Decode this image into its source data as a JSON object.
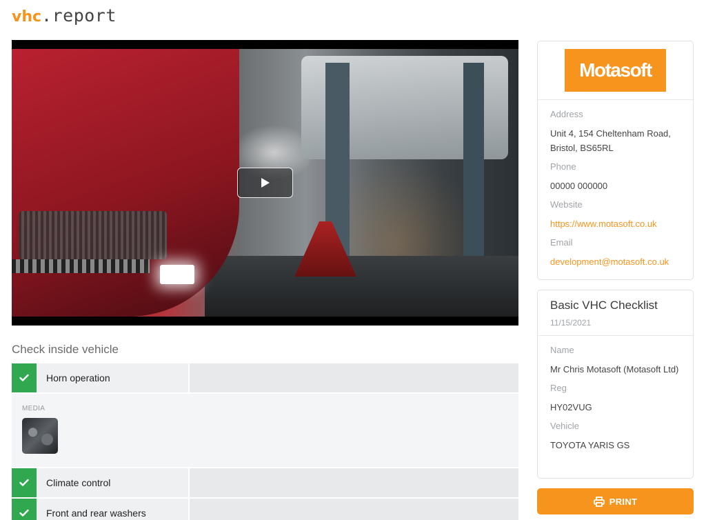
{
  "brand": {
    "part1": "vhc",
    "part2": ".report"
  },
  "video": {
    "play_icon": "play-icon"
  },
  "section": {
    "title": "Check inside vehicle"
  },
  "checks": [
    {
      "label": "Horn operation",
      "status": "pass"
    },
    {
      "label": "Climate control",
      "status": "pass"
    },
    {
      "label": "Front and rear washers",
      "status": "pass"
    }
  ],
  "media": {
    "label": "MEDIA"
  },
  "dealer": {
    "logo_text": "Motasoft",
    "address_label": "Address",
    "address": "Unit 4, 154 Cheltenham Road, Bristol, BS65RL",
    "phone_label": "Phone",
    "phone": "00000 000000",
    "website_label": "Website",
    "website": "https://www.motasoft.co.uk",
    "email_label": "Email",
    "email": "development@motasoft.co.uk"
  },
  "checklist": {
    "title": "Basic VHC Checklist",
    "date": "11/15/2021",
    "name_label": "Name",
    "name": "Mr Chris Motasoft (Motasoft Ltd)",
    "reg_label": "Reg",
    "reg": "HY02VUG",
    "vehicle_label": "Vehicle",
    "vehicle": "TOYOTA YARIS GS"
  },
  "print": {
    "label": "PRINT"
  },
  "colors": {
    "accent": "#f7941d",
    "pass": "#2fa84f"
  }
}
